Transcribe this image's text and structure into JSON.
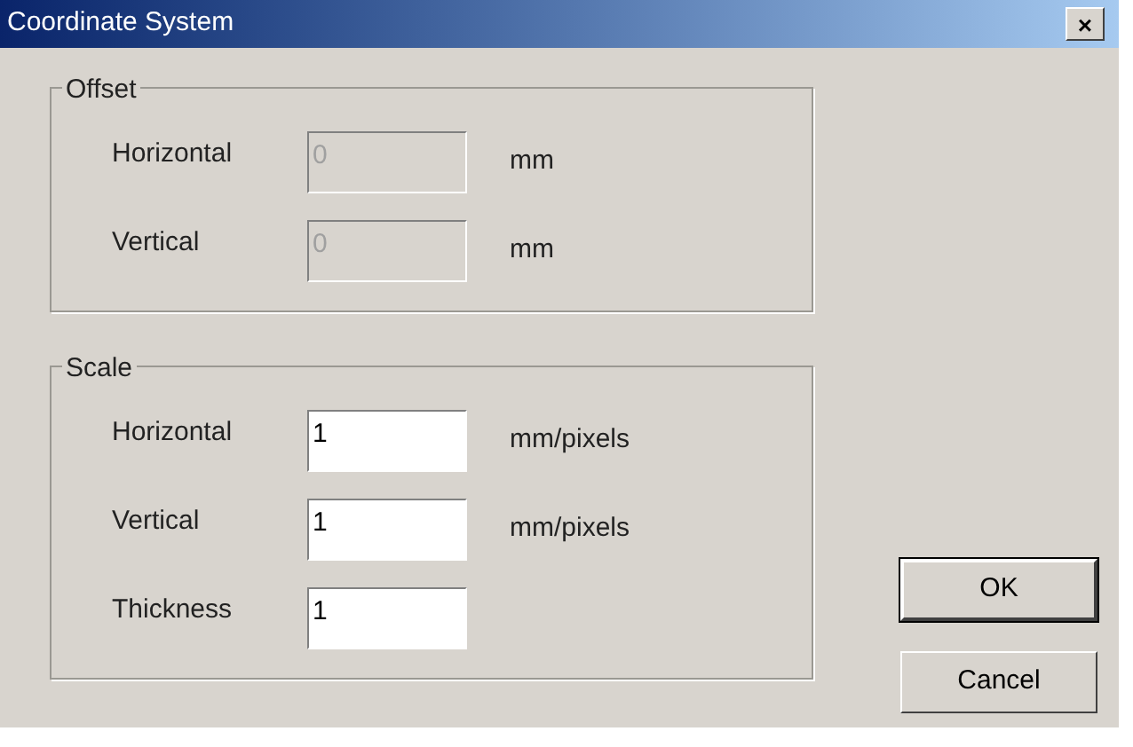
{
  "window": {
    "title": "Coordinate System",
    "close": "×"
  },
  "groups": [
    {
      "title": "Offset",
      "fields": [
        {
          "label": "Horizontal",
          "value": "0",
          "unit": "mm",
          "disabled": true
        },
        {
          "label": "Vertical",
          "value": "0",
          "unit": "mm",
          "disabled": true
        }
      ]
    },
    {
      "title": "Scale",
      "fields": [
        {
          "label": "Horizontal",
          "value": "1",
          "unit": "mm/pixels",
          "disabled": false
        },
        {
          "label": "Vertical",
          "value": "1",
          "unit": "mm/pixels",
          "disabled": false
        },
        {
          "label": "Thickness",
          "value": "1",
          "disabled": false
        }
      ]
    }
  ],
  "buttons": [
    {
      "label": "OK",
      "selected": true
    },
    {
      "label": "Cancel",
      "selected": false
    }
  ]
}
